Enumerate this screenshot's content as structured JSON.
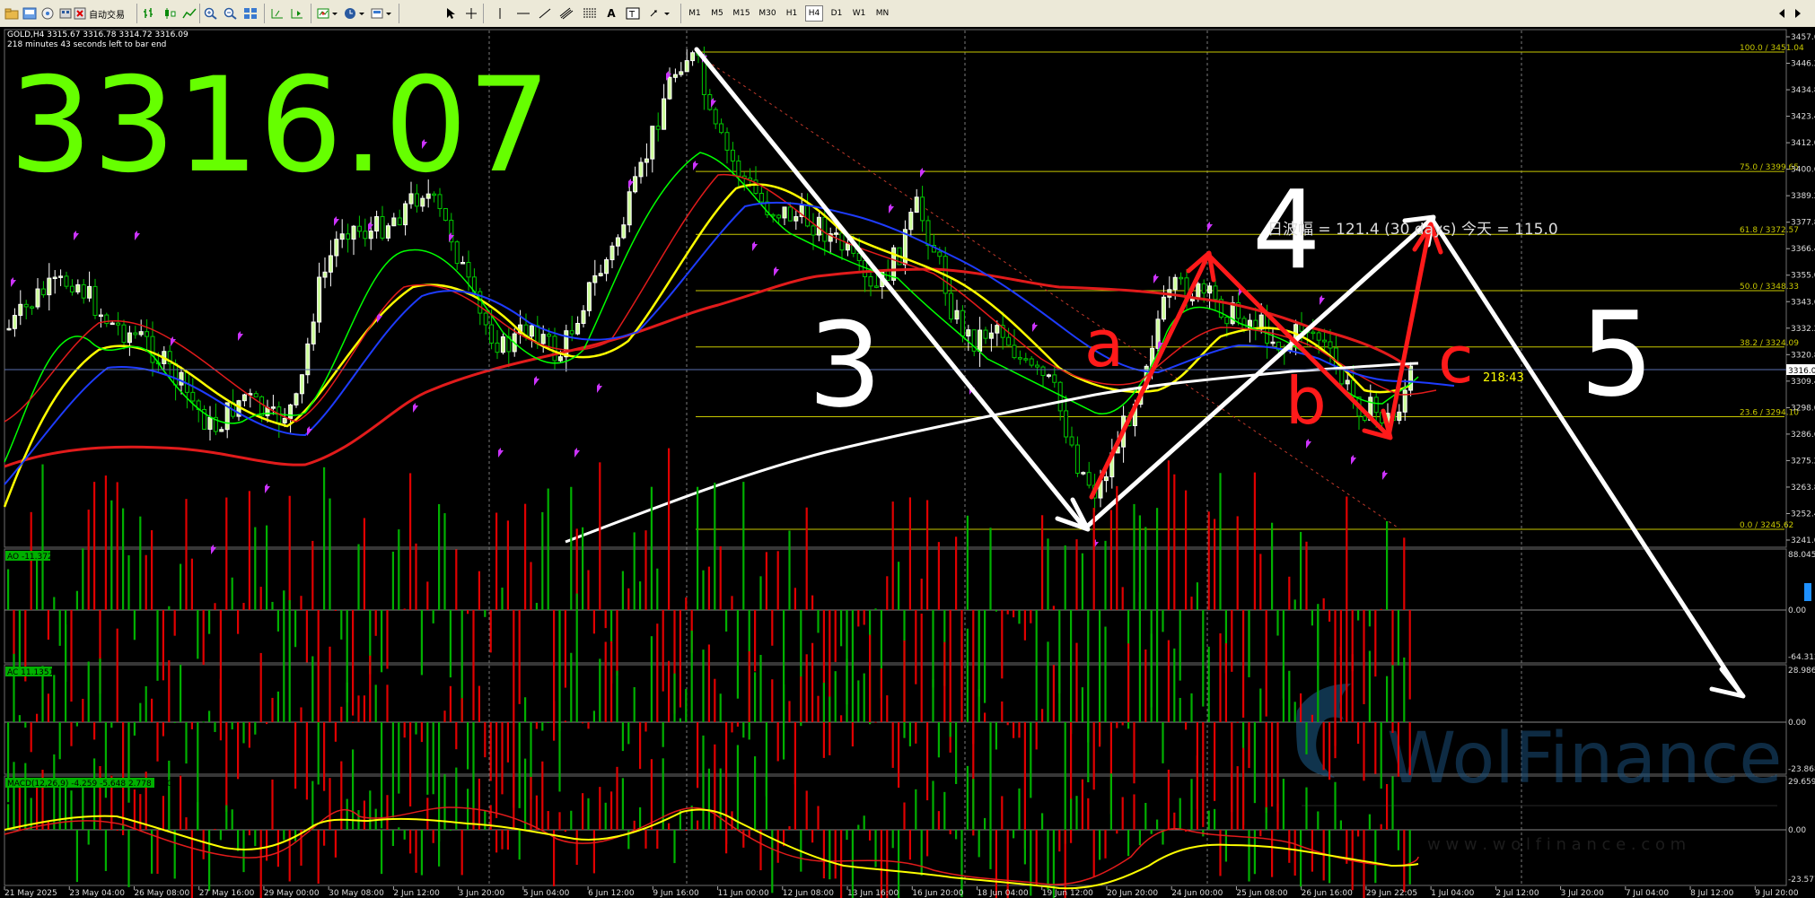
{
  "toolbar": {
    "auto_trading_label": "自动交易",
    "timeframes": [
      "M1",
      "M5",
      "M15",
      "M30",
      "H1",
      "H4",
      "D1",
      "W1",
      "MN"
    ],
    "active_timeframe": "H4"
  },
  "chart": {
    "header_line1": "GOLD,H4  3315.67 3316.78 3314.72 3316.09",
    "header_line2": "218 minutes 43 seconds left to bar end",
    "big_price": "3316.07",
    "current_price_tag": "3316.09",
    "countdown": "218:43",
    "daily_range_text": "日波幅 = 121.4   (30 days)        今天 = 115.0",
    "price_axis": [
      "3457.60",
      "3446.20",
      "3434.80",
      "3423.40",
      "3412.00",
      "3400.60",
      "3389.20",
      "3377.80",
      "3366.40",
      "3355.00",
      "3343.60",
      "3332.20",
      "3320.80",
      "3309.40",
      "3298.00",
      "3286.60",
      "3275.20",
      "3263.80",
      "3252.40",
      "3241.00"
    ],
    "date_axis": [
      "21 May 2025",
      "23 May 04:00",
      "26 May 08:00",
      "27 May 16:00",
      "29 May 00:00",
      "30 May 08:00",
      "2 Jun 12:00",
      "3 Jun 20:00",
      "5 Jun 04:00",
      "6 Jun 12:00",
      "9 Jun 16:00",
      "11 Jun 00:00",
      "12 Jun 08:00",
      "13 Jun 16:00",
      "16 Jun 20:00",
      "18 Jun 04:00",
      "19 Jun 12:00",
      "20 Jun 20:00",
      "24 Jun 00:00",
      "25 Jun 08:00",
      "26 Jun 16:00",
      "29 Jun 22:05",
      "1 Jul 04:00",
      "2 Jul 12:00",
      "3 Jul 20:00",
      "7 Jul 04:00",
      "8 Jul 12:00",
      "9 Jul 20:00"
    ],
    "fib_levels": [
      {
        "label": "100.0 / 3451.04",
        "price": 3451.04
      },
      {
        "label": "75.0 / 3399.65",
        "price": 3399.65
      },
      {
        "label": "61.8 / 3372.57",
        "price": 3372.57
      },
      {
        "label": "50.0 / 3348.33",
        "price": 3348.33
      },
      {
        "label": "38.2 / 3324.09",
        "price": 3324.09
      },
      {
        "label": "23.6 / 3294.10",
        "price": 3294.1
      },
      {
        "label": "0.0 / 3245.62",
        "price": 3245.62
      }
    ],
    "wave_labels": [
      "3",
      "4",
      "5",
      "a",
      "b",
      "c"
    ],
    "colors": {
      "bull": "#ffffff",
      "bear": "#00c800",
      "fib": "#c8c800",
      "ma_red": "#e11b1b",
      "ma_yellow": "#ffff00",
      "ma_green": "#00ff00",
      "ma_blue": "#1e3cff",
      "big_price": "#66ff00",
      "ao_up": "#00b000",
      "ao_down": "#e00000"
    }
  },
  "indicators": {
    "ao": {
      "label": "AO -11.372",
      "axis": [
        "88.045",
        "0.00",
        "-64.312"
      ]
    },
    "ac": {
      "label": "AC 11.1351",
      "axis": [
        "28.986",
        "0.00",
        "-23.868"
      ]
    },
    "macd": {
      "label": "MACD(12,26,9) -4.259 -5.648 2.778 0.000",
      "axis": [
        "29.659",
        "0.00",
        "-23.577"
      ]
    }
  },
  "watermark": {
    "brand": "WolFinance",
    "url": "w w w . w o l f i n a n c e . c o m"
  }
}
